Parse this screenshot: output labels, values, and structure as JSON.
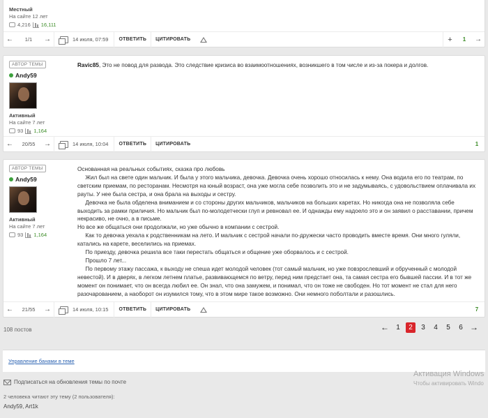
{
  "posts": [
    {
      "rank": "Местный",
      "since": "На сайте 12 лет",
      "comments": "4,216",
      "reputation": "16,111",
      "page": "1/1",
      "date": "14 июля, 07:59",
      "reply": "ОТВЕТИТЬ",
      "quote": "ЦИТИРОВАТЬ",
      "plus": "+",
      "score": "1"
    },
    {
      "badge": "АВТОР ТЕМЫ",
      "author": "Andy59",
      "rank": "Активный",
      "since": "На сайте 7 лет",
      "comments": "93",
      "reputation": "1,164",
      "quoted_user": "Ravic85",
      "text": ", Это не повод для развода. Это следствие кризиса во взаимоотношениях, возникшего в том числе и из-за покера и долгов.",
      "page": "20/55",
      "date": "14 июля, 10:04",
      "reply": "ОТВЕТИТЬ",
      "quote": "ЦИТИРОВАТЬ",
      "score": "1"
    },
    {
      "badge": "АВТОР ТЕМЫ",
      "author": "Andy59",
      "rank": "Активный",
      "since": "На сайте 7 лет",
      "comments": "93",
      "reputation": "1,164",
      "text": "Основанная на реальных событиях, сказка про любовь\n     Жил был на свете один мальчик. И была у этого мальчика, девочка. Девочка очень хорошо относилась к нему. Она водила его по театрам, по светским приемам, по ресторанам. Несмотря на юный возраст, она уже могла себе позволить это и не задумываясь, с удовольствием оплачивала их рауты. У нее была сестра, и она брала на выходы и сестру.\n     Девочка не была обделена вниманием и со стороны других мальчиков, мальчиков на больших каретах. Но никогда она не позволяла себе выходить за рамки приличия. Но мальчик был по-молодетчески глуп и ревновал ее. И однажды ему надоело это и он заявил о расставании, причем некрасиво, не очно, а в письме.\nНо все же общаться они продолжали, но уже обычно в компании с сестрой.\n     Как то девочка уехала к родственникам на лето. И мальчик с сестрой начали по-дружески часто проводить вместе время. Они много гуляли, катались на карете, веселились на приемах.\n     По приезду, девочка решила все таки перестать общаться и общение уже оборвалось и с сестрой.\n     Прошло 7 лет...\n     По первому этажу пассажа, к выходу не спеша идет молодой человек (тот самый мальчик, но уже повзрослевший и обрученный с молодой невестой). И в дверях, в легком летнем платье, развивающемся по ветру, перед ним предстает она, та самая сестра его бывшей пассии. И в тот же момент он понимает, что он всегда любил ее. Он знал, что она замужем, и понимал, что он тоже не свободен. Но тот момент не стал для него разочарованием, а наоборот он изумился тому, что в этом мире такое возможно. Они немного поболтали и разошлись.",
      "page": "21/55",
      "date": "14 июля, 10:15",
      "reply": "ОТВЕТИТЬ",
      "quote": "ЦИТИРОВАТЬ",
      "score": "7"
    }
  ],
  "pagination": {
    "total": "108 постов",
    "prev": "←",
    "next": "→",
    "pages": [
      "1",
      "2",
      "3",
      "4",
      "5",
      "6"
    ],
    "current": "2"
  },
  "moderation": {
    "link": "Управление банами в теме"
  },
  "subscribe": "Подписаться на обновления темы по почте",
  "readers": {
    "count_text": "2 человека читают эту тему (2 пользователя):",
    "names": "Andy59, Art1k"
  },
  "watermark": {
    "title": "Активация Windows",
    "subtitle": "Чтобы активировать Windo"
  },
  "colors": {
    "accent": "#d9252b",
    "reputation": "#3c8c27",
    "link": "#2a62b2",
    "online": "#3da13d"
  }
}
